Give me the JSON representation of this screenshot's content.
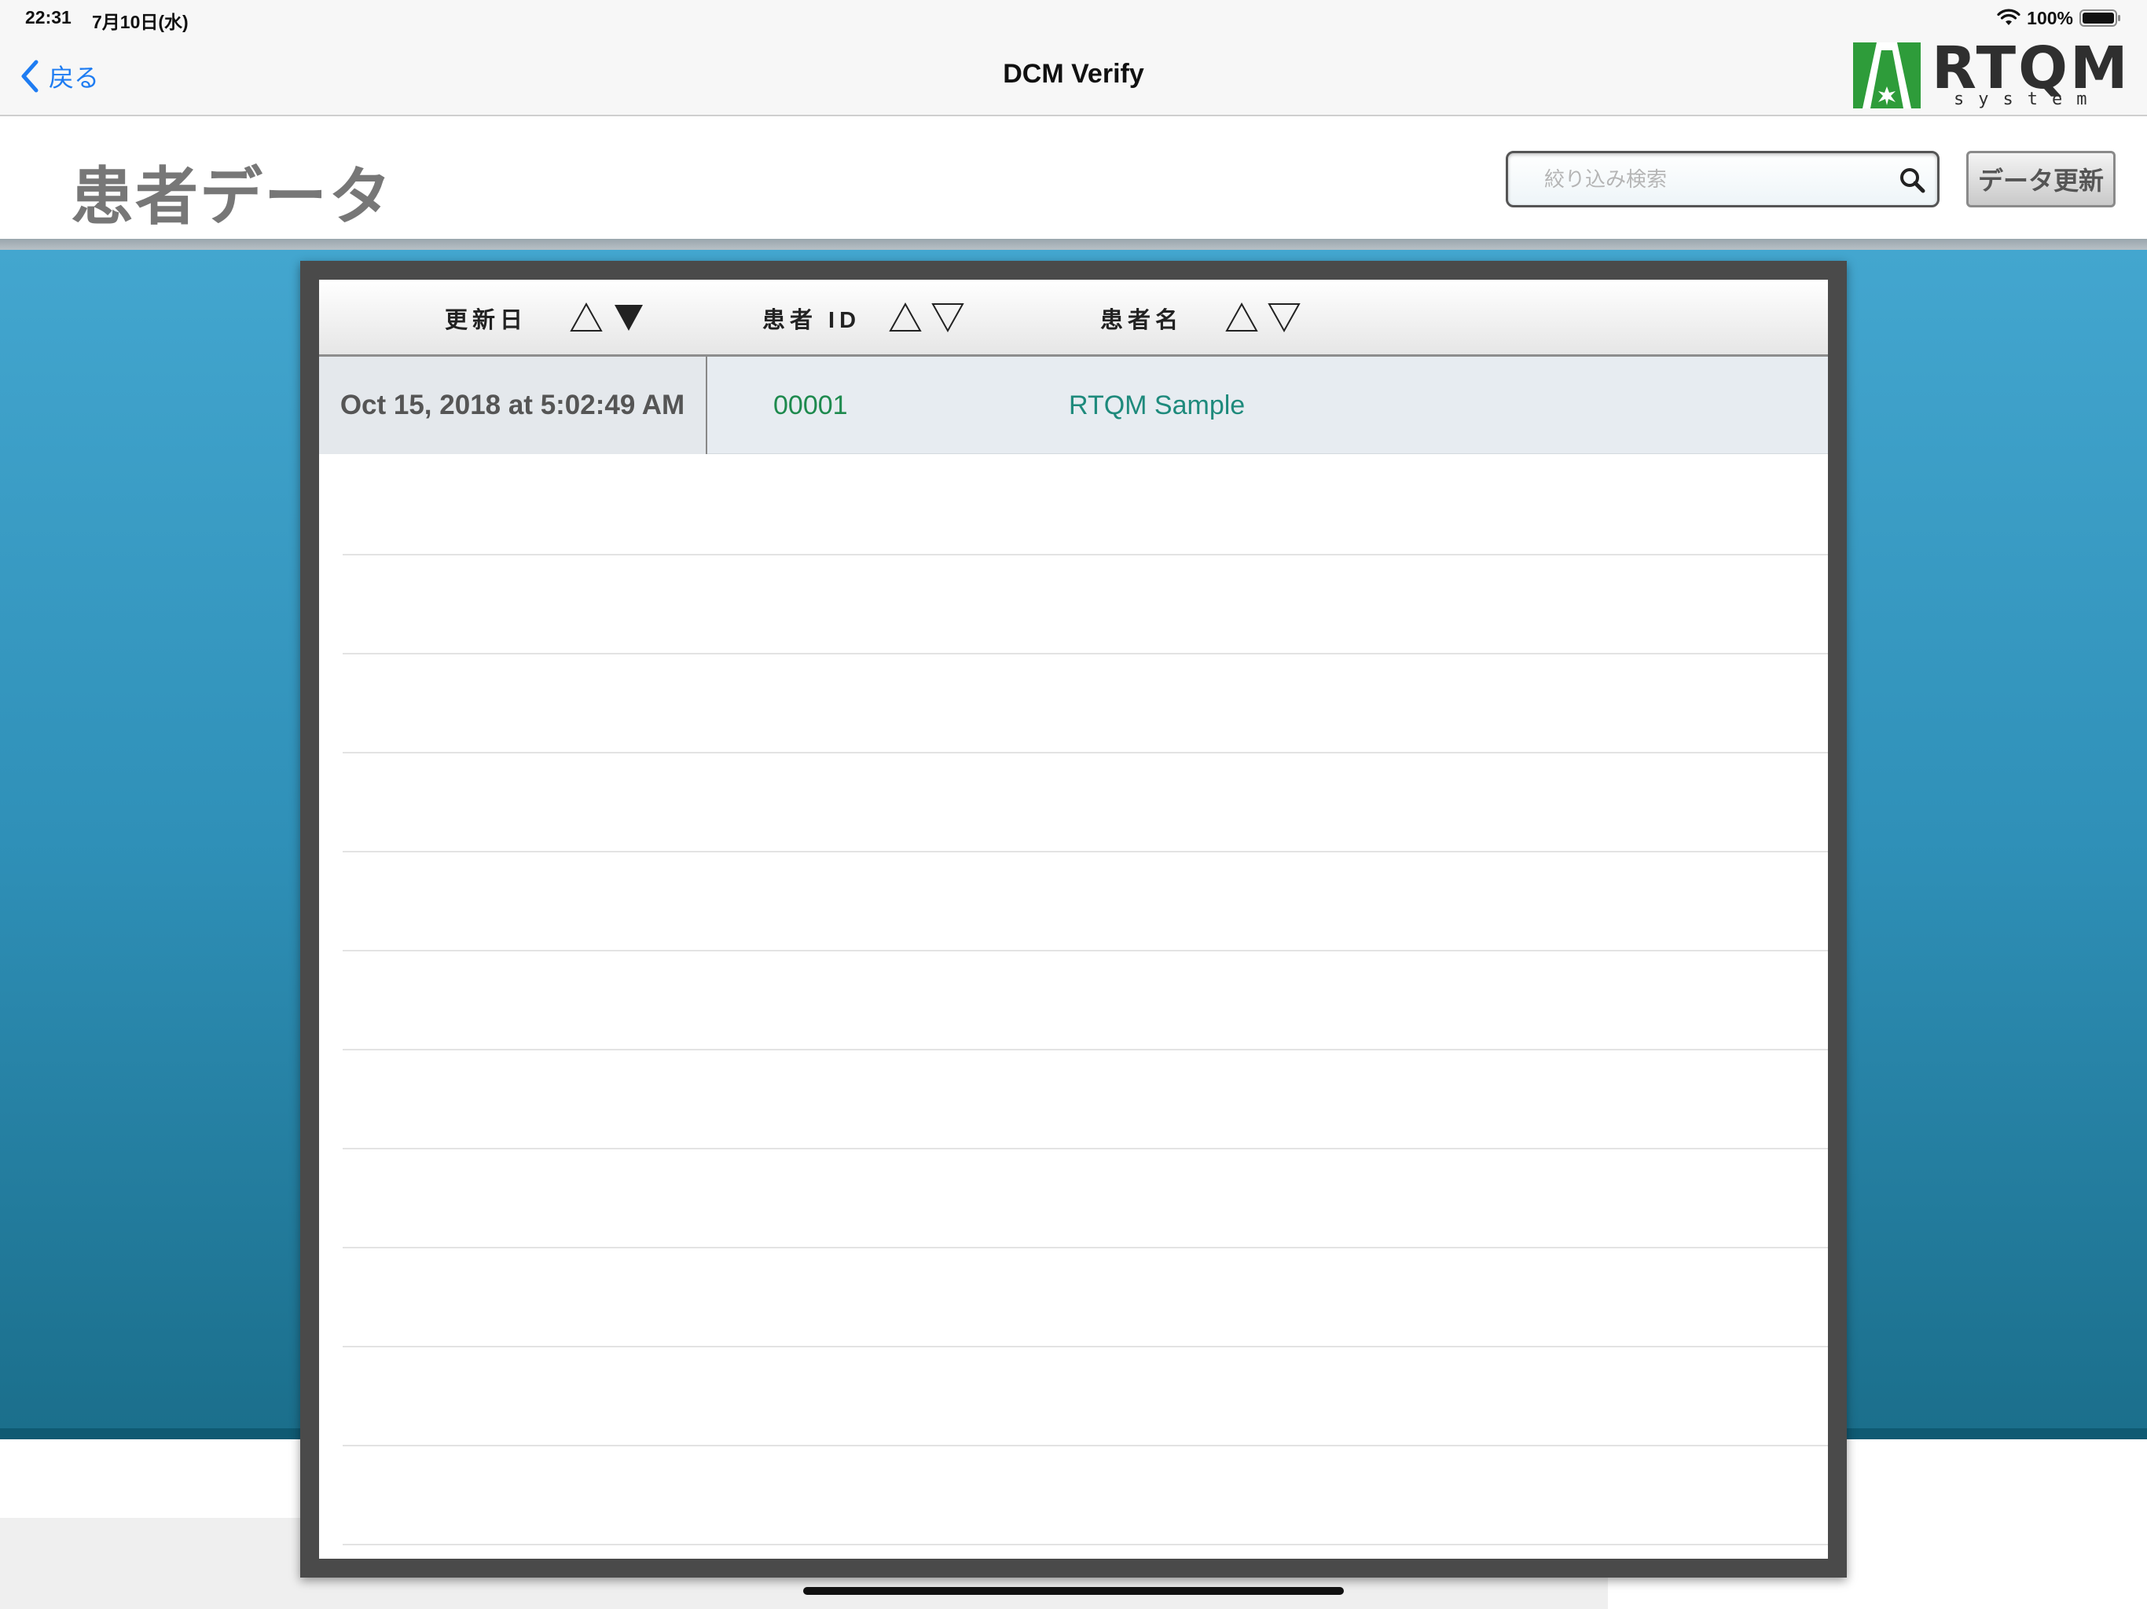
{
  "status_bar": {
    "time": "22:31",
    "date": "7月10日(水)",
    "battery": "100%"
  },
  "nav": {
    "back_label": "戻る",
    "title": "DCM Verify",
    "logo_text": "RTQM",
    "logo_subtext": "system"
  },
  "header": {
    "page_title": "患者データ",
    "search_placeholder": "絞り込み検索",
    "refresh_label": "データ更新"
  },
  "table": {
    "columns": [
      {
        "label": "更新日",
        "sort": "descending"
      },
      {
        "label": "患者 ID",
        "sort": "none"
      },
      {
        "label": "患者名",
        "sort": "none"
      }
    ],
    "rows": [
      {
        "updated": "Oct 15, 2018 at 5:02:49 AM",
        "patient_id": "00001",
        "patient_name": "RTQM Sample"
      }
    ]
  },
  "colors": {
    "accent": "#1e7cf2",
    "panel_blue": "#2f90b8",
    "id_green": "#1e8a4e",
    "name_teal": "#1e8a7c",
    "logo_green": "#2e9c3a"
  },
  "icons": {
    "back": "chevron-left-icon",
    "search": "magnifier-icon",
    "sort_asc": "triangle-up-outline-icon",
    "sort_desc_active": "triangle-down-filled-icon",
    "sort_desc": "triangle-down-outline-icon",
    "wifi": "wifi-icon",
    "battery": "battery-full-icon"
  }
}
